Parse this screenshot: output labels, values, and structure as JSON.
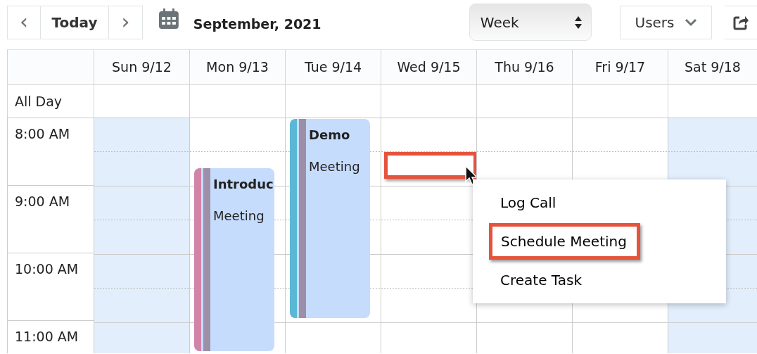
{
  "toolbar": {
    "prev": "‹",
    "today": "Today",
    "next": "›",
    "title": "September, 2021",
    "view": "Week",
    "users": "Users"
  },
  "days": [
    {
      "label": "Sun 9/12",
      "weekend": true,
      "slot_highlighted": false
    },
    {
      "label": "Mon 9/13",
      "weekend": false,
      "slot_highlighted": false,
      "events": [
        {
          "title": "Introduc",
          "type": "Meeting",
          "color": "#d184a8"
        }
      ]
    },
    {
      "label": "Tue 9/14",
      "weekend": false,
      "slot_highlighted": false,
      "events": [
        {
          "title": "Demo",
          "type": "Meeting",
          "color": "#5bb8d4"
        }
      ]
    },
    {
      "label": "Wed 9/15",
      "weekend": false,
      "slot_highlighted": true
    },
    {
      "label": "Thu 9/16",
      "weekend": false,
      "slot_highlighted": false
    },
    {
      "label": "Fri 9/17",
      "weekend": false,
      "slot_highlighted": false
    },
    {
      "label": "Sat 9/18",
      "weekend": true,
      "slot_highlighted": false
    }
  ],
  "all_day_label": "All Day",
  "hours": [
    "8:00 AM",
    "9:00 AM",
    "10:00 AM",
    "11:00 AM"
  ],
  "context_menu": [
    {
      "label": "Log Call",
      "highlighted": false
    },
    {
      "label": "Schedule Meeting",
      "highlighted": true
    },
    {
      "label": "Create Task",
      "highlighted": false
    }
  ]
}
